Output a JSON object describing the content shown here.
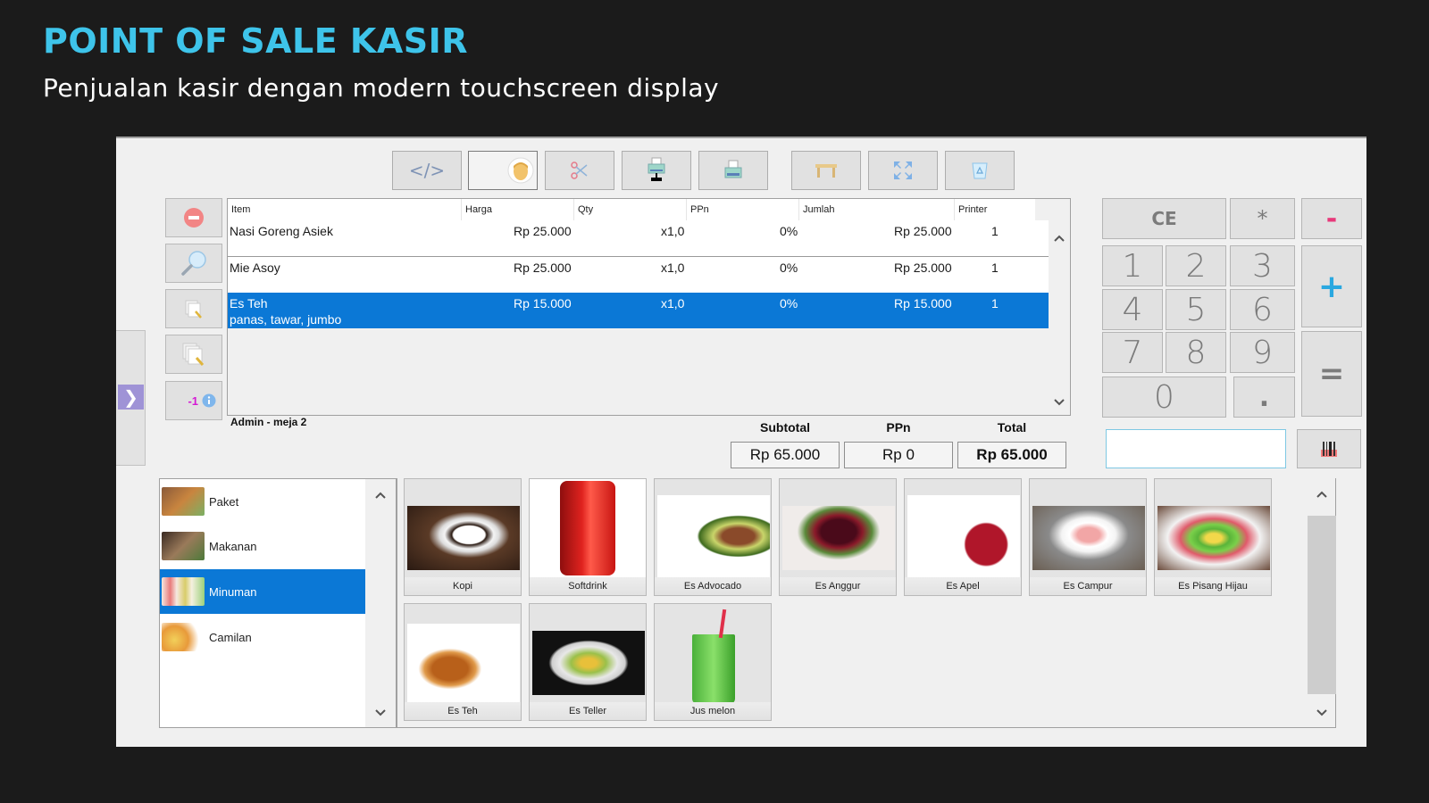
{
  "header": {
    "title": "POINT OF SALE KASIR",
    "subtitle": "Penjualan kasir dengan modern touchscreen display"
  },
  "toolbar": {
    "buttons": [
      {
        "icon": "code-icon"
      },
      {
        "icon": "user-avatar-icon",
        "selected": true
      },
      {
        "icon": "scissors-icon"
      },
      {
        "icon": "printer-network-icon"
      },
      {
        "icon": "printer-icon"
      },
      {
        "icon": "table-icon"
      },
      {
        "icon": "fullscreen-icon"
      },
      {
        "icon": "trash-icon"
      }
    ]
  },
  "left_actions": {
    "delete": "delete-icon",
    "search": "search-icon",
    "edit_note": "edit-note-icon",
    "edit_notes": "edit-notes-icon",
    "decrement_label": "-1"
  },
  "grid": {
    "columns": [
      "Item",
      "Harga",
      "Qty",
      "PPn",
      "Jumlah",
      "Printer"
    ],
    "rows": [
      {
        "item": "Nasi Goreng Asiek",
        "note": "",
        "harga": "Rp 25.000",
        "qty": "x1,0",
        "ppn": "0%",
        "jumlah": "Rp 25.000",
        "printer": "1",
        "selected": false
      },
      {
        "item": "Mie Asoy",
        "note": "",
        "harga": "Rp 25.000",
        "qty": "x1,0",
        "ppn": "0%",
        "jumlah": "Rp 25.000",
        "printer": "1",
        "selected": false
      },
      {
        "item": "Es Teh",
        "note": "panas, tawar, jumbo",
        "harga": "Rp 15.000",
        "qty": "x1,0",
        "ppn": "0%",
        "jumlah": "Rp 15.000",
        "printer": "1",
        "selected": true
      }
    ],
    "scroll_up": "^",
    "scroll_down": "v"
  },
  "status": {
    "user_table": "Admin - meja 2"
  },
  "totals": {
    "subtotal_label": "Subtotal",
    "subtotal_value": "Rp 65.000",
    "ppn_label": "PPn",
    "ppn_value": "Rp 0",
    "total_label": "Total",
    "total_value": "Rp 65.000"
  },
  "keypad": {
    "ce": "CE",
    "multiply": "*",
    "minus": "-",
    "plus": "+",
    "equals": "=",
    "dot": ".",
    "digits": [
      "1",
      "2",
      "3",
      "4",
      "5",
      "6",
      "7",
      "8",
      "9",
      "0"
    ],
    "input_value": "",
    "barcode_icon": "barcode-icon"
  },
  "categories": [
    {
      "label": "Paket",
      "selected": false
    },
    {
      "label": "Makanan",
      "selected": false
    },
    {
      "label": "Minuman",
      "selected": true
    },
    {
      "label": "Camilan",
      "selected": false
    }
  ],
  "products": [
    {
      "label": "Kopi"
    },
    {
      "label": "Softdrink"
    },
    {
      "label": "Es Advocado"
    },
    {
      "label": "Es Anggur"
    },
    {
      "label": "Es Apel"
    },
    {
      "label": "Es Campur"
    },
    {
      "label": "Es Pisang Hijau"
    },
    {
      "label": "Es Teh"
    },
    {
      "label": "Es Teller"
    },
    {
      "label": "Jus melon"
    }
  ],
  "colors": {
    "accent_title": "#3ec4ea",
    "selection_blue": "#0b78d6",
    "minus_pink": "#e8397a",
    "plus_blue": "#2aa8e0",
    "side_toggle": "#9f93d6",
    "decrement_magenta": "#d41ad4"
  }
}
